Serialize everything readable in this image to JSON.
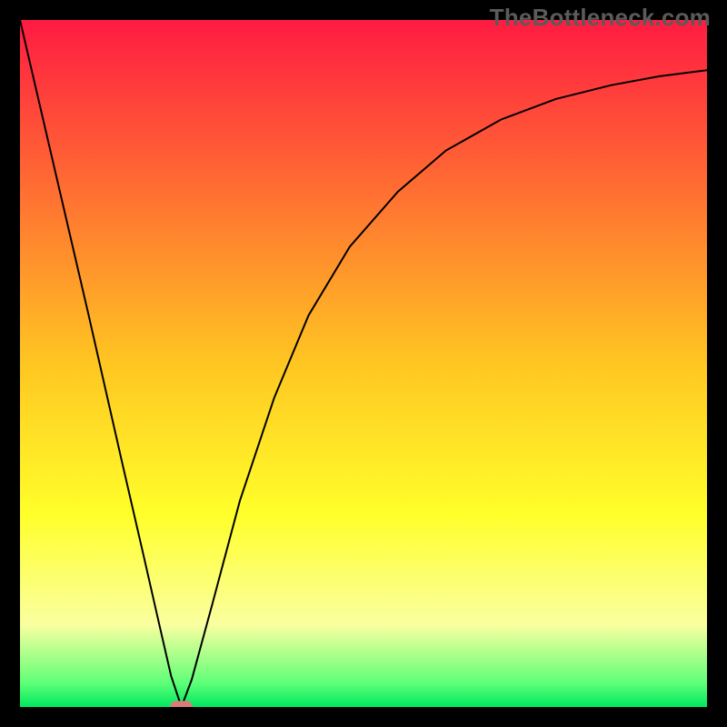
{
  "watermark": "TheBottleneck.com",
  "chart_data": {
    "type": "line",
    "title": "",
    "xlabel": "",
    "ylabel": "",
    "xlim": [
      0,
      100
    ],
    "ylim": [
      0,
      100
    ],
    "grid": false,
    "legend": false,
    "background_gradient": {
      "stops": [
        {
          "offset": 0.0,
          "color": "#ff1b42"
        },
        {
          "offset": 0.25,
          "color": "#ff6f32"
        },
        {
          "offset": 0.5,
          "color": "#ffc622"
        },
        {
          "offset": 0.72,
          "color": "#ffff2a"
        },
        {
          "offset": 0.88,
          "color": "#faffa0"
        },
        {
          "offset": 0.965,
          "color": "#5fff78"
        },
        {
          "offset": 1.0,
          "color": "#00e85f"
        }
      ]
    },
    "series": [
      {
        "name": "bottleneck-curve",
        "color": "#000000",
        "stroke_width": 2,
        "x": [
          0,
          5,
          10,
          15,
          18,
          20,
          22,
          23.5,
          25,
          28,
          32,
          37,
          42,
          48,
          55,
          62,
          70,
          78,
          86,
          93,
          100
        ],
        "values": [
          100,
          78.5,
          57,
          35,
          22,
          13.2,
          4.5,
          0,
          4,
          15,
          30,
          45,
          57,
          67,
          75,
          81,
          85.5,
          88.5,
          90.5,
          91.8,
          92.7
        ]
      }
    ],
    "minimum_marker": {
      "shape": "rounded-rect",
      "x": 23.5,
      "y": 0,
      "width_pct": 3.3,
      "height_pct": 1.8,
      "color": "#d87b79"
    }
  }
}
